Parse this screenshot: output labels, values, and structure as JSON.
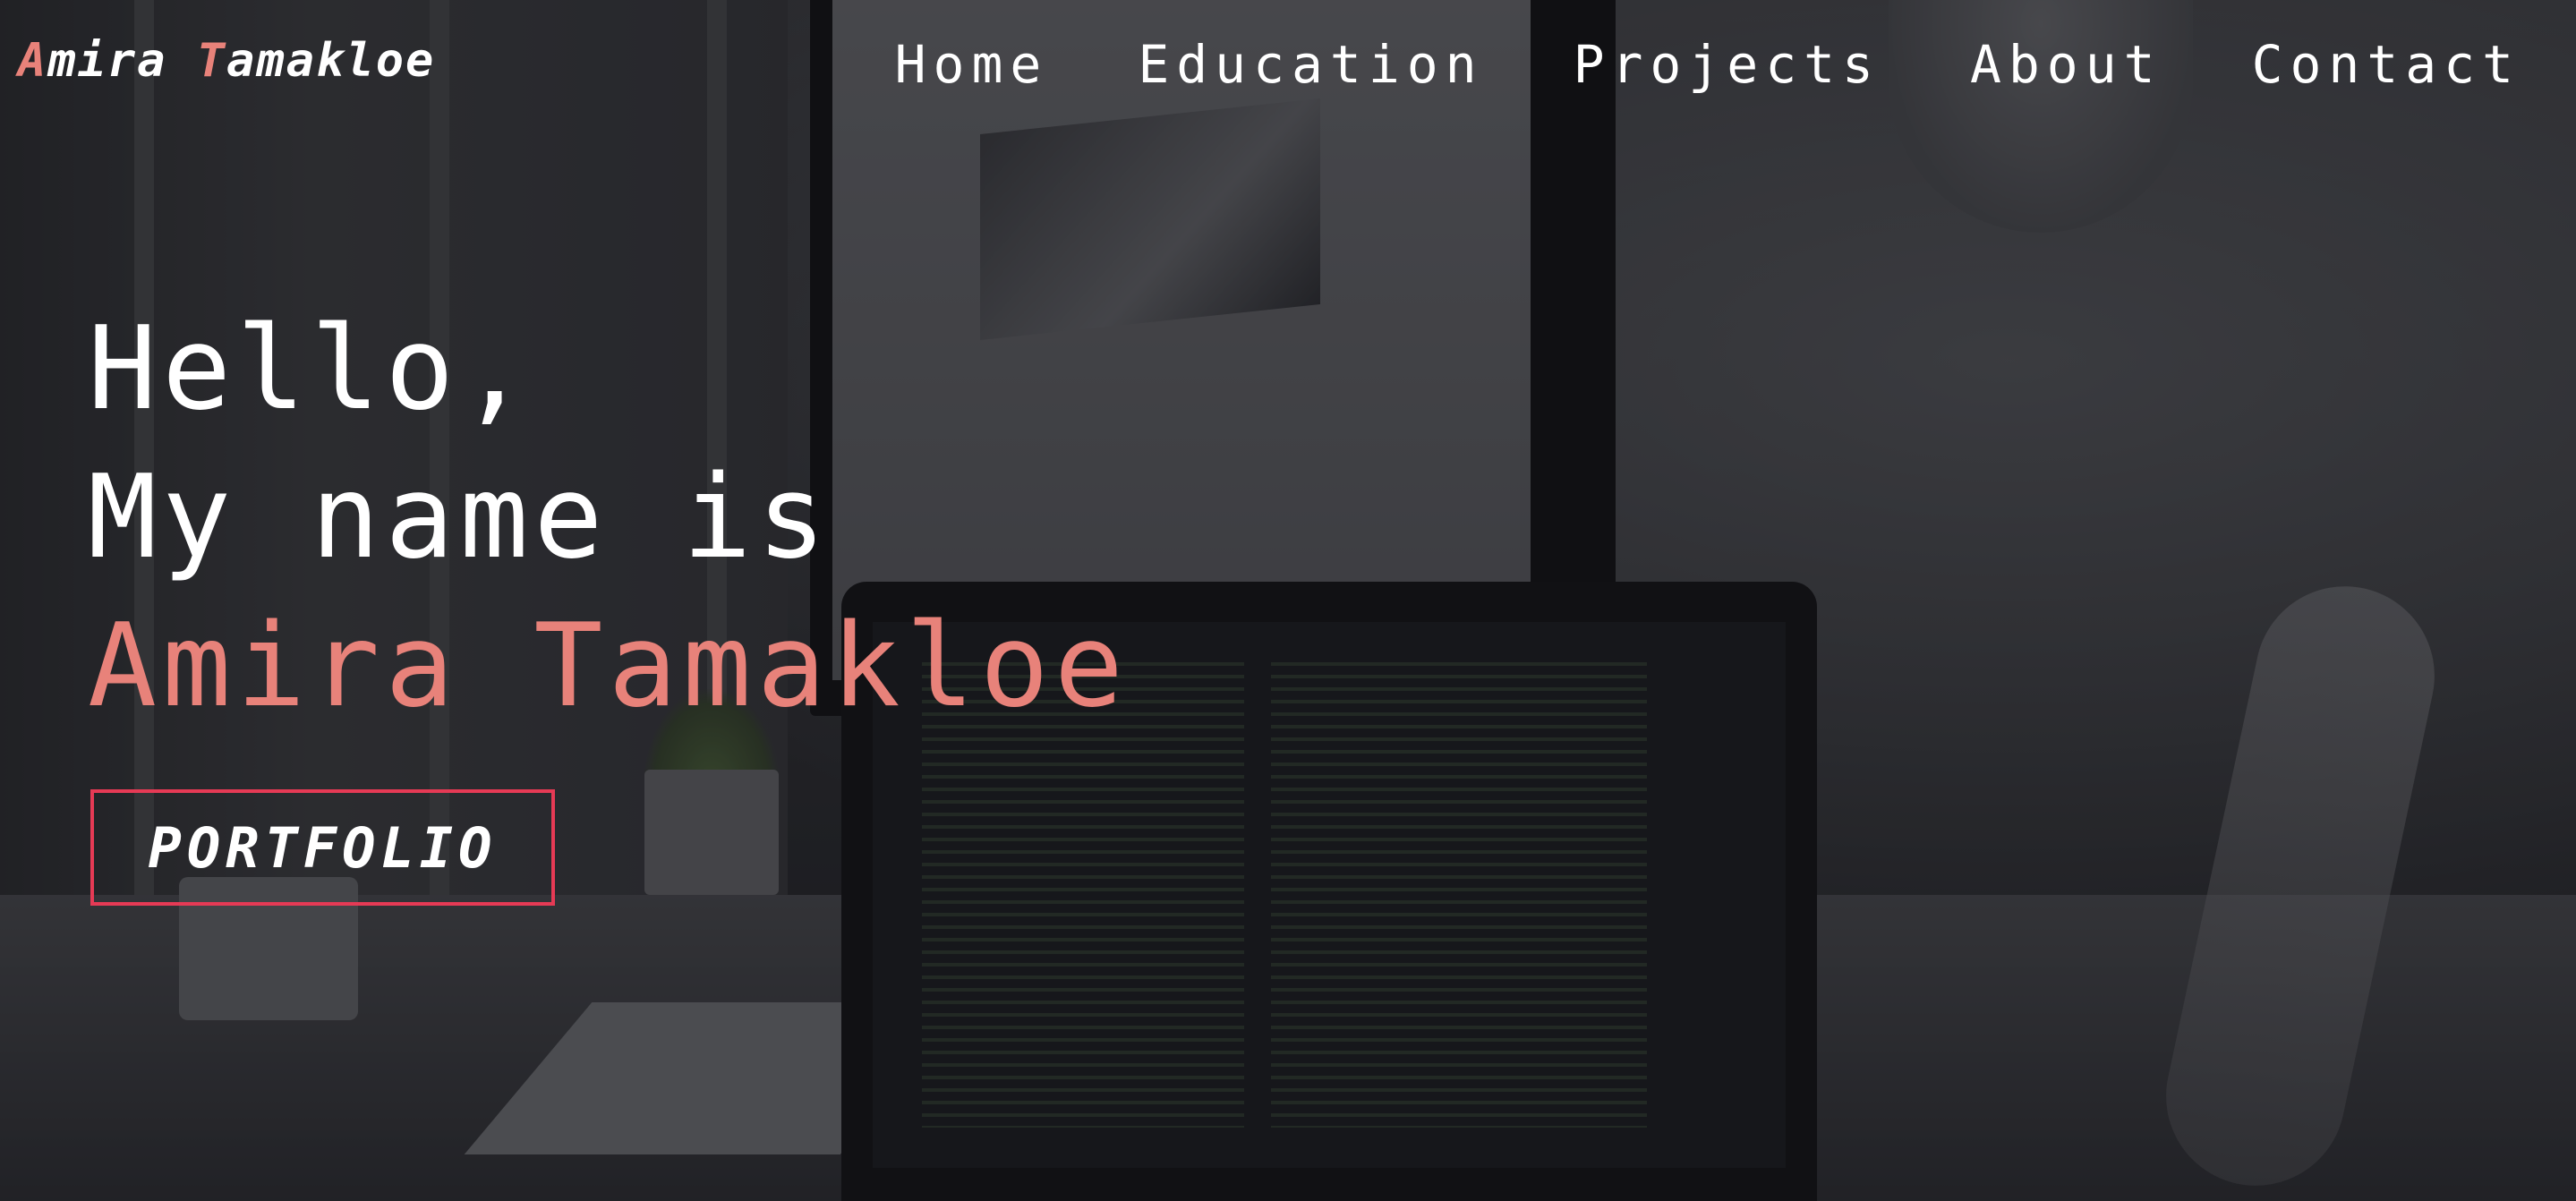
{
  "header": {
    "logo_first_initial": "A",
    "logo_first_rest": "mira ",
    "logo_last_initial": "T",
    "logo_last_rest": "amakloe",
    "nav": [
      {
        "label": "Home"
      },
      {
        "label": "Education"
      },
      {
        "label": "Projects"
      },
      {
        "label": "About"
      },
      {
        "label": "Contact"
      }
    ]
  },
  "hero": {
    "greeting": "Hello,",
    "intro": "My name is",
    "name": "Amira Tamakloe",
    "cta_label": "PORTFOLIO",
    "background_image": "desk-workspace-photo"
  },
  "colors": {
    "accent": "#e8827a",
    "button_border": "#e63a55",
    "text": "#ffffff"
  }
}
